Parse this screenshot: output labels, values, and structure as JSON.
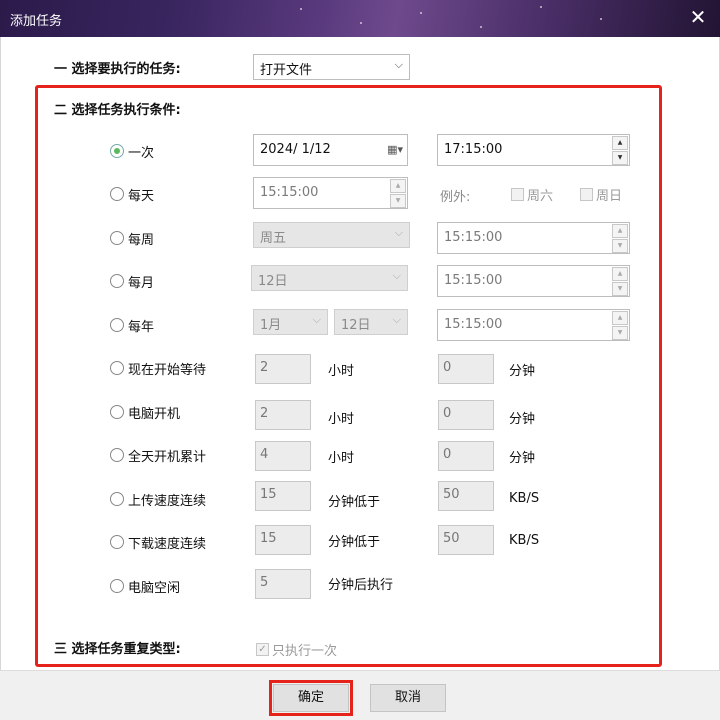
{
  "window": {
    "title": "添加任务",
    "close_glyph": "✕"
  },
  "section1": {
    "title": "一 选择要执行的任务:",
    "task_select": "打开文件"
  },
  "section2": {
    "title": "二 选择任务执行条件:",
    "once": {
      "label": "一次",
      "date": "2024/  1/12",
      "time": "17:15:00",
      "checked": true
    },
    "daily": {
      "label": "每天",
      "time": "15:15:00",
      "except_label": "例外:",
      "saturday": "周六",
      "sunday": "周日"
    },
    "weekly": {
      "label": "每周",
      "day_select": "周五",
      "time": "15:15:00"
    },
    "monthly": {
      "label": "每月",
      "day_select": "12日",
      "time": "15:15:00"
    },
    "yearly": {
      "label": "每年",
      "month_select": "1月",
      "day_select": "12日",
      "time": "15:15:00"
    },
    "wait_from_now": {
      "label": "现在开始等待",
      "hours": "2",
      "hours_unit": "小时",
      "minutes": "0",
      "minutes_unit": "分钟"
    },
    "computer_on": {
      "label": "电脑开机",
      "hours": "2",
      "hours_unit": "小时",
      "minutes": "0",
      "minutes_unit": "分钟"
    },
    "daily_uptime": {
      "label": "全天开机累计",
      "hours": "4",
      "hours_unit": "小时",
      "minutes": "0",
      "minutes_unit": "分钟"
    },
    "upload_speed": {
      "label": "上传速度连续",
      "minutes": "15",
      "minutes_unit": "分钟低于",
      "speed": "50",
      "speed_unit": "KB/S"
    },
    "download_speed": {
      "label": "下载速度连续",
      "minutes": "15",
      "minutes_unit": "分钟低于",
      "speed": "50",
      "speed_unit": "KB/S"
    },
    "idle": {
      "label": "电脑空闲",
      "minutes": "5",
      "minutes_unit": "分钟后执行"
    }
  },
  "section3": {
    "title": "三 选择任务重复类型:",
    "once_only": "只执行一次"
  },
  "buttons": {
    "ok": "确定",
    "cancel": "取消"
  },
  "colors": {
    "highlight": "#e5231b",
    "radio_checked": "#5cb85c"
  }
}
